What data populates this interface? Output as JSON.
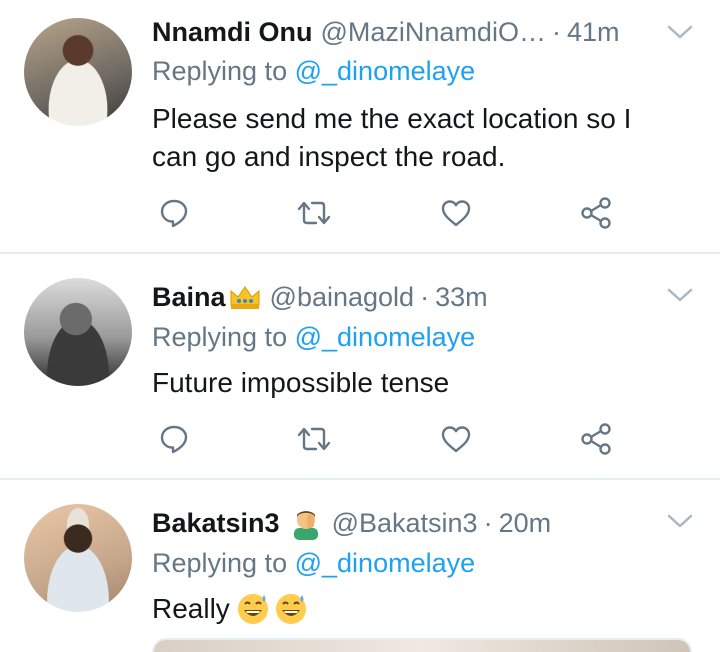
{
  "tweets": [
    {
      "name": "Nnamdi Onu",
      "handle": "@MaziNnamdiO…",
      "time": "41m",
      "reply_prefix": "Replying to",
      "reply_mention": "@_dinomelaye",
      "text_line1": "Please send me the exact location so I",
      "text_line2": "can go and inspect the road."
    },
    {
      "name": "Baina",
      "handle": "@bainagold",
      "time": "33m",
      "reply_prefix": "Replying to",
      "reply_mention": "@_dinomelaye",
      "text_line1": "Future impossible tense"
    },
    {
      "name": "Bakatsin3",
      "handle": "@Bakatsin3",
      "time": "20m",
      "reply_prefix": "Replying to",
      "reply_mention": "@_dinomelaye",
      "text_line1": "Really"
    }
  ],
  "separator": "·",
  "icons": {
    "reply": "reply-icon",
    "retweet": "retweet-icon",
    "like": "heart-icon",
    "share": "share-icon",
    "menu": "chevron-down-icon",
    "crown": "crown-emoji-icon",
    "facepalm": "facepalm-emoji-icon",
    "sweat": "grinning-sweat-emoji-icon"
  },
  "colors": {
    "link": "#1da1f2",
    "muted": "#657786",
    "text": "#14171a",
    "divider": "#e6ecf0"
  }
}
